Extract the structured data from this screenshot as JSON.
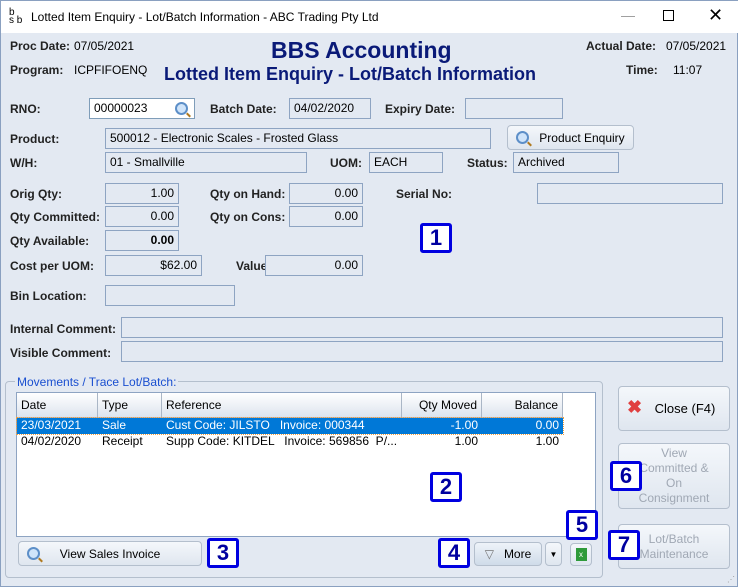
{
  "window": {
    "title": "Lotted Item Enquiry - Lot/Batch Information - ABC Trading Pty Ltd",
    "logo": "bbs"
  },
  "header": {
    "proc_date_label": "Proc Date:",
    "proc_date": "07/05/2021",
    "program_label": "Program:",
    "program": "ICPFIFOENQ",
    "app_title": "BBS Accounting",
    "screen_title": "Lotted Item Enquiry - Lot/Batch Information",
    "actual_date_label": "Actual Date:",
    "actual_date": "07/05/2021",
    "time_label": "Time:",
    "time": "11:07"
  },
  "form": {
    "rno_label": "RNO:",
    "rno": "00000023",
    "batch_date_label": "Batch Date:",
    "batch_date": "04/02/2020",
    "expiry_date_label": "Expiry Date:",
    "expiry_date": "",
    "product_label": "Product:",
    "product": "500012 - Electronic Scales - Frosted Glass",
    "product_enquiry": "Product Enquiry",
    "wh_label": "W/H:",
    "wh": "01 - Smallville",
    "uom_label": "UOM:",
    "uom": "EACH",
    "status_label": "Status:",
    "status": "Archived",
    "orig_qty_label": "Orig Qty:",
    "orig_qty": "1.00",
    "qty_on_hand_label": "Qty on Hand:",
    "qty_on_hand": "0.00",
    "serial_no_label": "Serial No:",
    "serial_no": "",
    "qty_committed_label": "Qty Committed:",
    "qty_committed": "0.00",
    "qty_on_cons_label": "Qty on Cons:",
    "qty_on_cons": "0.00",
    "qty_available_label": "Qty Available:",
    "qty_available": "0.00",
    "cost_per_uom_label": "Cost per UOM:",
    "cost_per_uom": "$62.00",
    "value_label": "Value:",
    "value": "0.00",
    "bin_location_label": "Bin Location:",
    "bin_location": "",
    "internal_comment_label": "Internal Comment:",
    "internal_comment": "",
    "visible_comment_label": "Visible Comment:",
    "visible_comment": ""
  },
  "movements": {
    "group_label": "Movements / Trace Lot/Batch:",
    "columns": [
      "Date",
      "Type",
      "Reference",
      "Qty Moved",
      "Balance"
    ],
    "rows": [
      [
        "23/03/2021",
        "Sale",
        "Cust Code: JILSTO   Invoice: 000344",
        "-1.00",
        "0.00"
      ],
      [
        "04/02/2020",
        "Receipt",
        "Supp Code: KITDEL   Invoice: 569856  P/...",
        "1.00",
        "1.00"
      ]
    ],
    "view_sales_invoice": "View Sales Invoice",
    "more": "More"
  },
  "side": {
    "close": "Close (F4)",
    "view_committed": "View Committed & On Consignment",
    "lot_batch_maintenance": "Lot/Batch Maintenance"
  },
  "badges": [
    "1",
    "2",
    "3",
    "4",
    "5",
    "6",
    "7"
  ],
  "colors": {
    "title": "#0a1a78",
    "selection": "#0078d7",
    "badge": "#0000e0",
    "group_label": "#1a4fd0"
  }
}
